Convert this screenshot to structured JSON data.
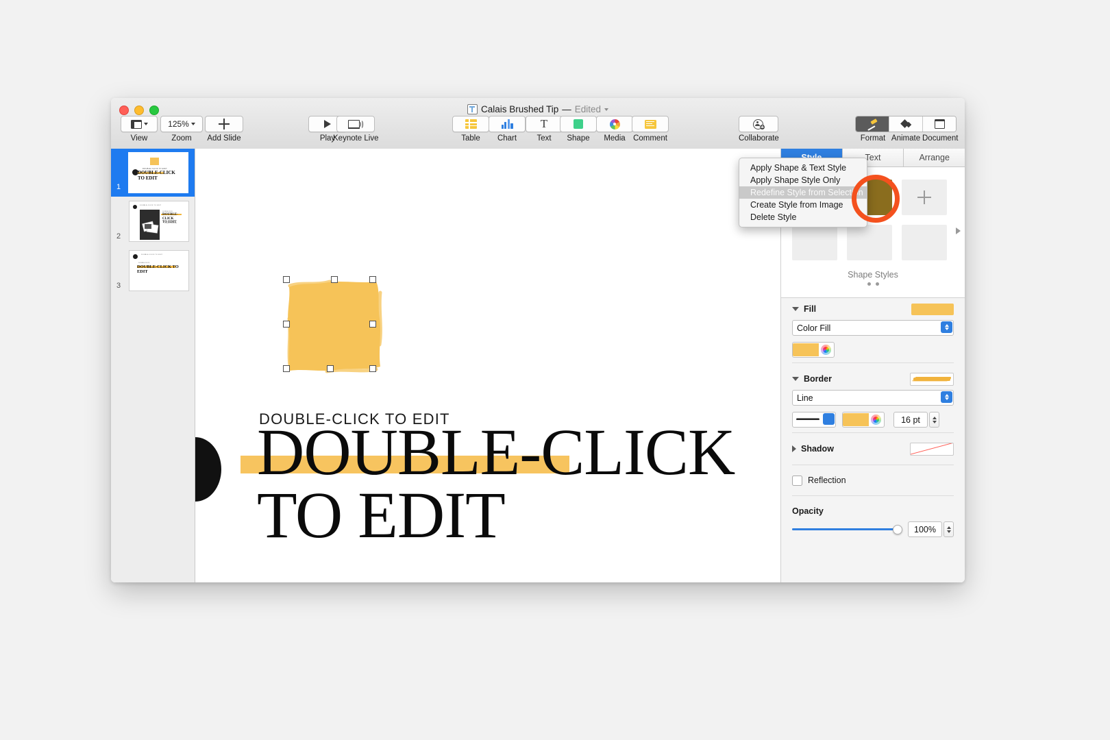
{
  "window": {
    "title": "Calais Brushed Tip",
    "title_separator": "—",
    "edited_label": "Edited"
  },
  "toolbar": {
    "left_items": [
      {
        "label": "View",
        "icon": "view-layout-icon",
        "has_chevron": true
      },
      {
        "label": "Zoom",
        "value": "125%",
        "icon": "zoom-value",
        "has_chevron": true
      },
      {
        "label": "Add Slide",
        "icon": "plus-icon",
        "has_chevron": false
      }
    ],
    "play_items": [
      {
        "label": "Play",
        "icon": "play-icon"
      },
      {
        "label": "Keynote Live",
        "icon": "keynote-live-icon"
      }
    ],
    "insert_items": [
      {
        "label": "Table",
        "icon": "table-icon"
      },
      {
        "label": "Chart",
        "icon": "chart-icon"
      },
      {
        "label": "Text",
        "icon": "text-icon"
      },
      {
        "label": "Shape",
        "icon": "shape-icon"
      },
      {
        "label": "Media",
        "icon": "media-icon"
      },
      {
        "label": "Comment",
        "icon": "comment-icon"
      }
    ],
    "collaborate": {
      "label": "Collaborate",
      "icon": "collaborate-icon"
    },
    "segmented": [
      {
        "label": "Format",
        "icon": "format-paintbrush-icon",
        "active": true
      },
      {
        "label": "Animate",
        "icon": "animate-diamond-icon",
        "active": false
      },
      {
        "label": "Document",
        "icon": "document-icon",
        "active": false
      }
    ]
  },
  "navigator": {
    "slides": [
      {
        "number": "1",
        "selected": true,
        "title": "DOUBLE-CLICK TO EDIT",
        "eyebrow": "DOUBLE-CLICK TO EDIT"
      },
      {
        "number": "2",
        "selected": false,
        "title": "DOUBLE-CLICK TO EDIT",
        "eyebrow": "DOUBLE-CLICK TO EDIT",
        "sub": "Double-Click to Edit"
      },
      {
        "number": "3",
        "selected": false,
        "title": "DOUBLE-CLICK TO EDIT",
        "eyebrow": "DOUBLE-CLICK TO EDIT"
      }
    ]
  },
  "canvas": {
    "eyebrow_text": "DOUBLE-CLICK TO EDIT",
    "headline_line1": "DOUBLE-CLICK",
    "headline_line2": "TO EDIT",
    "shape_fill": "#f6c358",
    "highlight_color": "#f7c45f"
  },
  "inspector": {
    "tabs": [
      {
        "label": "Style",
        "active": true
      },
      {
        "label": "Text",
        "active": false
      },
      {
        "label": "Arrange",
        "active": false
      }
    ],
    "shape_styles_caption": "Shape Styles",
    "context_menu": {
      "items": [
        {
          "label": "Apply Shape & Text Style",
          "highlighted": false
        },
        {
          "label": "Apply Shape Style Only",
          "highlighted": false
        },
        {
          "label": "Redefine Style from Selection",
          "highlighted": true
        },
        {
          "label": "Create Style from Image",
          "highlighted": false
        },
        {
          "label": "Delete Style",
          "highlighted": false
        }
      ]
    },
    "fill": {
      "label": "Fill",
      "type_value": "Color Fill",
      "color": "#f6c358",
      "preview_color": "#f6c358",
      "expanded": true
    },
    "border": {
      "label": "Border",
      "type_value": "Line",
      "color": "#f6c358",
      "width_value": "16 pt",
      "expanded": true
    },
    "shadow": {
      "label": "Shadow",
      "expanded": false
    },
    "reflection": {
      "label": "Reflection",
      "checked": false
    },
    "opacity": {
      "label": "Opacity",
      "value": "100%",
      "percent": 100
    }
  }
}
